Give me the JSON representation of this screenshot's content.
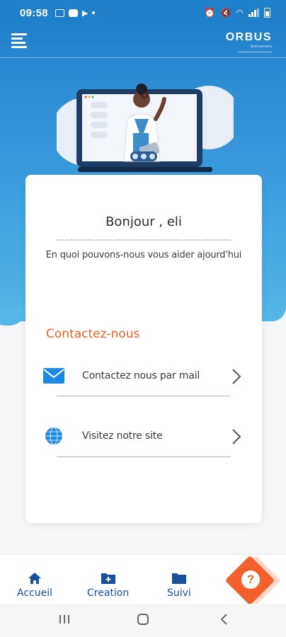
{
  "status_bar": {
    "time": "09:58"
  },
  "header": {
    "logo_main": "ORBUS",
    "logo_sub": "Entreprises"
  },
  "card": {
    "greeting": "Bonjour , eli",
    "subtitle": "En quoi pouvons-nous vous aider ajourd'hui",
    "section_title": "Contactez-nous",
    "options": [
      {
        "label": "Contactez nous par mail",
        "icon": "mail-icon"
      },
      {
        "label": "Visitez notre site",
        "icon": "globe-icon"
      }
    ]
  },
  "bottom_nav": {
    "items": [
      {
        "label": "Accueil",
        "icon": "home-icon"
      },
      {
        "label": "Creation",
        "icon": "folder-plus-icon"
      },
      {
        "label": "Suivi",
        "icon": "folder-icon"
      }
    ],
    "help_label": "?"
  },
  "colors": {
    "primary": "#1f7fc9",
    "accent": "#e8612c",
    "nav_text": "#1a4f9b"
  }
}
